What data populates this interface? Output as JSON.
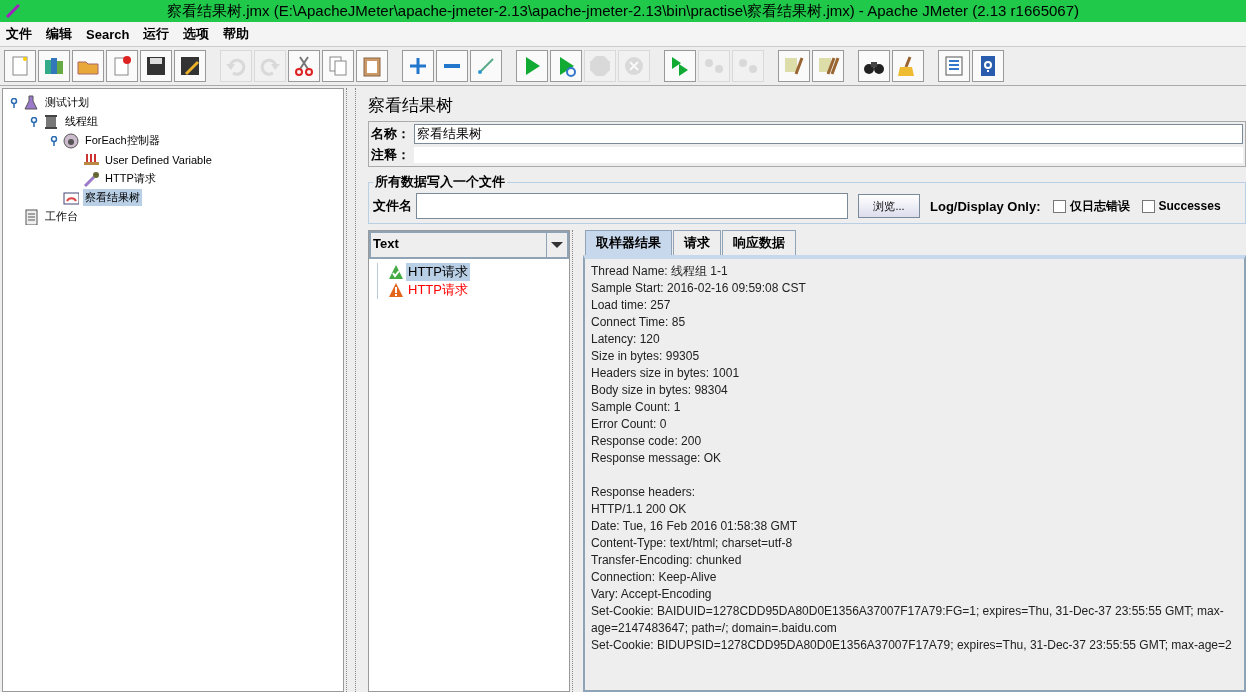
{
  "window": {
    "title": "察看结果树.jmx (E:\\ApacheJMeter\\apache-jmeter-2.13\\apache-jmeter-2.13\\bin\\practise\\察看结果树.jmx) - Apache JMeter (2.13 r1665067)"
  },
  "menu": [
    "文件",
    "编辑",
    "Search",
    "运行",
    "选项",
    "帮助"
  ],
  "toolbar": [
    {
      "kind": "new",
      "disabled": false
    },
    {
      "kind": "templates",
      "disabled": false
    },
    {
      "kind": "open",
      "disabled": false
    },
    {
      "kind": "close",
      "disabled": false
    },
    {
      "kind": "save",
      "disabled": false
    },
    {
      "kind": "save-as",
      "disabled": false
    },
    {
      "kind": "sep"
    },
    {
      "kind": "undo",
      "disabled": true
    },
    {
      "kind": "redo",
      "disabled": true
    },
    {
      "kind": "cut",
      "disabled": false
    },
    {
      "kind": "copy",
      "disabled": false
    },
    {
      "kind": "paste",
      "disabled": false
    },
    {
      "kind": "sep"
    },
    {
      "kind": "expand",
      "disabled": false
    },
    {
      "kind": "collapse",
      "disabled": false
    },
    {
      "kind": "toggle",
      "disabled": false
    },
    {
      "kind": "sep"
    },
    {
      "kind": "start",
      "disabled": false
    },
    {
      "kind": "start-no-timers",
      "disabled": false
    },
    {
      "kind": "stop",
      "disabled": true
    },
    {
      "kind": "shutdown",
      "disabled": true
    },
    {
      "kind": "sep"
    },
    {
      "kind": "remote-start",
      "disabled": false
    },
    {
      "kind": "remote-stop",
      "disabled": true
    },
    {
      "kind": "remote-shutdown",
      "disabled": true
    },
    {
      "kind": "sep"
    },
    {
      "kind": "clear",
      "disabled": false
    },
    {
      "kind": "clear-all",
      "disabled": false
    },
    {
      "kind": "sep"
    },
    {
      "kind": "search",
      "disabled": false
    },
    {
      "kind": "reset-search",
      "disabled": false
    },
    {
      "kind": "sep"
    },
    {
      "kind": "function-helper",
      "disabled": false
    },
    {
      "kind": "help",
      "disabled": false
    }
  ],
  "tree": [
    {
      "label": "测试计划",
      "kind": "plan",
      "selected": false,
      "expanded": true,
      "children": [
        {
          "label": "线程组",
          "kind": "thread-group",
          "selected": false,
          "expanded": true,
          "children": [
            {
              "label": "ForEach控制器",
              "kind": "controller",
              "selected": false,
              "expanded": true,
              "children": [
                {
                  "label": "User Defined Variable",
                  "kind": "variables",
                  "selected": false
                },
                {
                  "label": "HTTP请求",
                  "kind": "sampler",
                  "selected": false
                }
              ]
            },
            {
              "label": "察看结果树",
              "kind": "listener",
              "selected": true
            }
          ]
        }
      ]
    },
    {
      "label": "工作台",
      "kind": "workbench",
      "selected": false
    }
  ],
  "panel": {
    "title": "察看结果树",
    "name_label": "名称：",
    "name_value": "察看结果树",
    "comment_label": "注释：",
    "file_group": {
      "legend": "所有数据写入一个文件",
      "file_label": "文件名",
      "browse_button": "浏览...",
      "log_label": "Log/Display Only:",
      "checkboxes": [
        {
          "label": "仅日志错误",
          "checked": false
        },
        {
          "label": "Successes",
          "checked": false
        }
      ]
    }
  },
  "renderer": {
    "value": "Text"
  },
  "results": [
    {
      "label": "HTTP请求",
      "kind": "success",
      "selected": true
    },
    {
      "label": "HTTP请求",
      "kind": "error",
      "selected": false
    }
  ],
  "tabs": [
    {
      "label": "取样器结果",
      "selected": true
    },
    {
      "label": "请求",
      "selected": false
    },
    {
      "label": "响应数据",
      "selected": false
    }
  ],
  "sampler_result": [
    "Thread Name: 线程组 1-1",
    "Sample Start: 2016-02-16 09:59:08 CST",
    "Load time: 257",
    "Connect Time: 85",
    "Latency: 120",
    "Size in bytes: 99305",
    "Headers size in bytes: 1001",
    "Body size in bytes: 98304",
    "Sample Count: 1",
    "Error Count: 0",
    "Response code: 200",
    "Response message: OK"
  ],
  "response_headers": [
    "Response headers:",
    "HTTP/1.1 200 OK",
    "Date: Tue, 16 Feb 2016 01:58:38 GMT",
    "Content-Type: text/html; charset=utf-8",
    "Transfer-Encoding: chunked",
    "Connection: Keep-Alive",
    "Vary: Accept-Encoding",
    "Set-Cookie: BAIDUID=1278CDD95DA80D0E1356A37007F17A79:FG=1; expires=Thu, 31-Dec-37 23:55:55 GMT; max-age=2147483647; path=/; domain=.baidu.com",
    "Set-Cookie: BIDUPSID=1278CDD95DA80D0E1356A37007F17A79; expires=Thu, 31-Dec-37 23:55:55 GMT; max-age=2"
  ]
}
